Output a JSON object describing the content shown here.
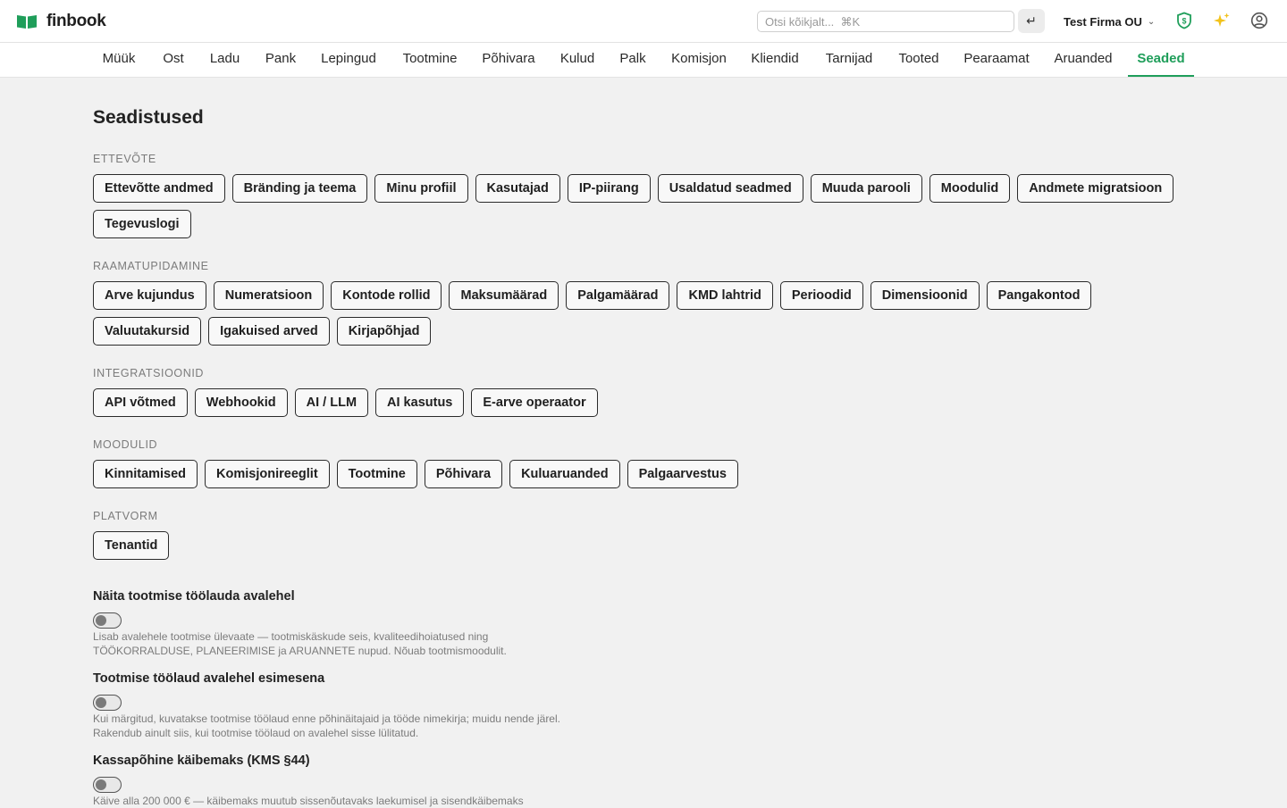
{
  "app": {
    "name": "finbook",
    "brand_color": "#1f9e5a"
  },
  "header": {
    "search_placeholder": "Otsi kõikjalt...  ⌘K",
    "enter_symbol": "↵",
    "company": "Test Firma OU",
    "company_chevron": "⌄",
    "icons": [
      "book-logo-icon",
      "enter-icon",
      "shield-dollar-icon",
      "sparkles-icon",
      "user-circle-icon"
    ]
  },
  "nav": {
    "items": [
      "Müük",
      "Ost",
      "Ladu",
      "Pank",
      "Lepingud",
      "Tootmine",
      "Põhivara",
      "Kulud",
      "Palk",
      "Komisjon",
      "Kliendid",
      "Tarnijad",
      "Tooted",
      "Pearaamat",
      "Aruanded",
      "Seaded"
    ],
    "active": "Seaded"
  },
  "page": {
    "title": "Seadistused"
  },
  "sections": [
    {
      "label": "ETTEVÕTE",
      "items": [
        "Ettevõtte andmed",
        "Bränding ja teema",
        "Minu profiil",
        "Kasutajad",
        "IP-piirang",
        "Usaldatud seadmed",
        "Muuda parooli",
        "Moodulid",
        "Andmete migratsioon",
        "Tegevuslogi"
      ]
    },
    {
      "label": "RAAMATUPIDAMINE",
      "items": [
        "Arve kujundus",
        "Numeratsioon",
        "Kontode rollid",
        "Maksumäärad",
        "Palgamäärad",
        "KMD lahtrid",
        "Perioodid",
        "Dimensioonid",
        "Pangakontod",
        "Valuutakursid",
        "Igakuised arved",
        "Kirjapõhjad"
      ]
    },
    {
      "label": "INTEGRATSIOONID",
      "items": [
        "API võtmed",
        "Webhookid",
        "AI / LLM",
        "AI kasutus",
        "E-arve operaator"
      ]
    },
    {
      "label": "MOODULID",
      "items": [
        "Kinnitamised",
        "Komisjonireeglit",
        "Tootmine",
        "Põhivara",
        "Kuluaruanded",
        "Palgaarvestus"
      ]
    },
    {
      "label": "PLATVORM",
      "items": [
        "Tenantid"
      ]
    }
  ],
  "toggles": [
    {
      "title": "Näita tootmise töölauda avalehel",
      "on": false,
      "desc": [
        "Lisab avalehele tootmise ülevaate — tootmiskäskude seis, kvaliteedihoiatused ning",
        "TÖÖKORRALDUSE, PLANEERIMISE ja ARUANNETE nupud. Nõuab tootmismoodulit."
      ]
    },
    {
      "title": "Tootmise töölaud avalehel esimesena",
      "on": false,
      "desc": [
        "Kui märgitud, kuvatakse tootmise töölaud enne põhinäitajaid ja tööde nimekirja; muidu nende järel.",
        "Rakendub ainult siis, kui tootmise töölaud on avalehel sisse lülitatud."
      ]
    },
    {
      "title": "Kassapõhine käibemaks (KMS §44)",
      "on": false,
      "desc": [
        "Käive alla 200 000 € — käibemaks muutub sissenõutavaks laekumisel ja sisendkäibemaks",
        ""
      ]
    }
  ]
}
